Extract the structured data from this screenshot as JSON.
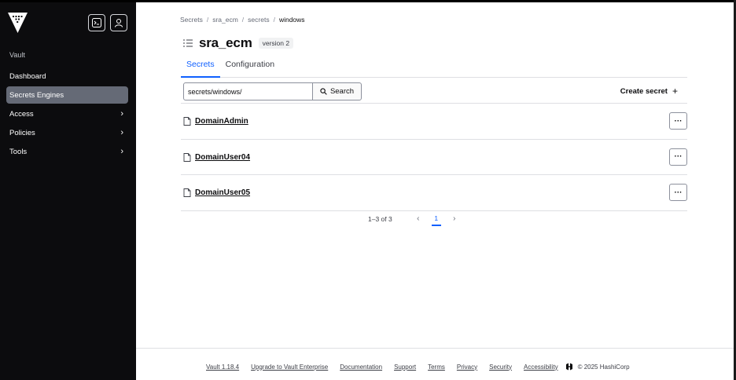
{
  "sidebar": {
    "section_label": "Vault",
    "items": [
      {
        "label": "Dashboard",
        "has_chevron": false
      },
      {
        "label": "Secrets Engines",
        "has_chevron": false,
        "active": true
      },
      {
        "label": "Access",
        "has_chevron": true
      },
      {
        "label": "Policies",
        "has_chevron": true
      },
      {
        "label": "Tools",
        "has_chevron": true
      }
    ],
    "chevron": "›",
    "icons": {
      "logo": "vault-logo-icon",
      "console": "terminal-icon",
      "user": "user-icon"
    }
  },
  "breadcrumb": [
    "Secrets",
    "sra_ecm",
    "secrets",
    "windows"
  ],
  "breadcrumb_sep": "/",
  "header": {
    "title": "sra_ecm",
    "version_badge": "version 2"
  },
  "tabs": [
    {
      "label": "Secrets",
      "active": true
    },
    {
      "label": "Configuration",
      "active": false
    }
  ],
  "toolbar": {
    "search_value": "secrets/windows/",
    "search_button": "Search",
    "create_button": "Create secret",
    "create_plus": "+"
  },
  "secrets": [
    {
      "name": "DomainAdmin"
    },
    {
      "name": "DomainUser04"
    },
    {
      "name": "DomainUser05"
    }
  ],
  "more_button": "···",
  "pagination": {
    "info": "1–3 of 3",
    "prev": "‹",
    "current_page": "1",
    "next": "›"
  },
  "footer": {
    "links": [
      "Vault 1.18.4",
      "Upgrade to Vault Enterprise",
      "Documentation",
      "Support",
      "Terms",
      "Privacy",
      "Security",
      "Accessibility"
    ],
    "copyright": "© 2025 HashiCorp"
  },
  "colors": {
    "sidebar_bg": "#0c0c0e",
    "active_nav": "#656a76",
    "accent": "#1060ff"
  }
}
